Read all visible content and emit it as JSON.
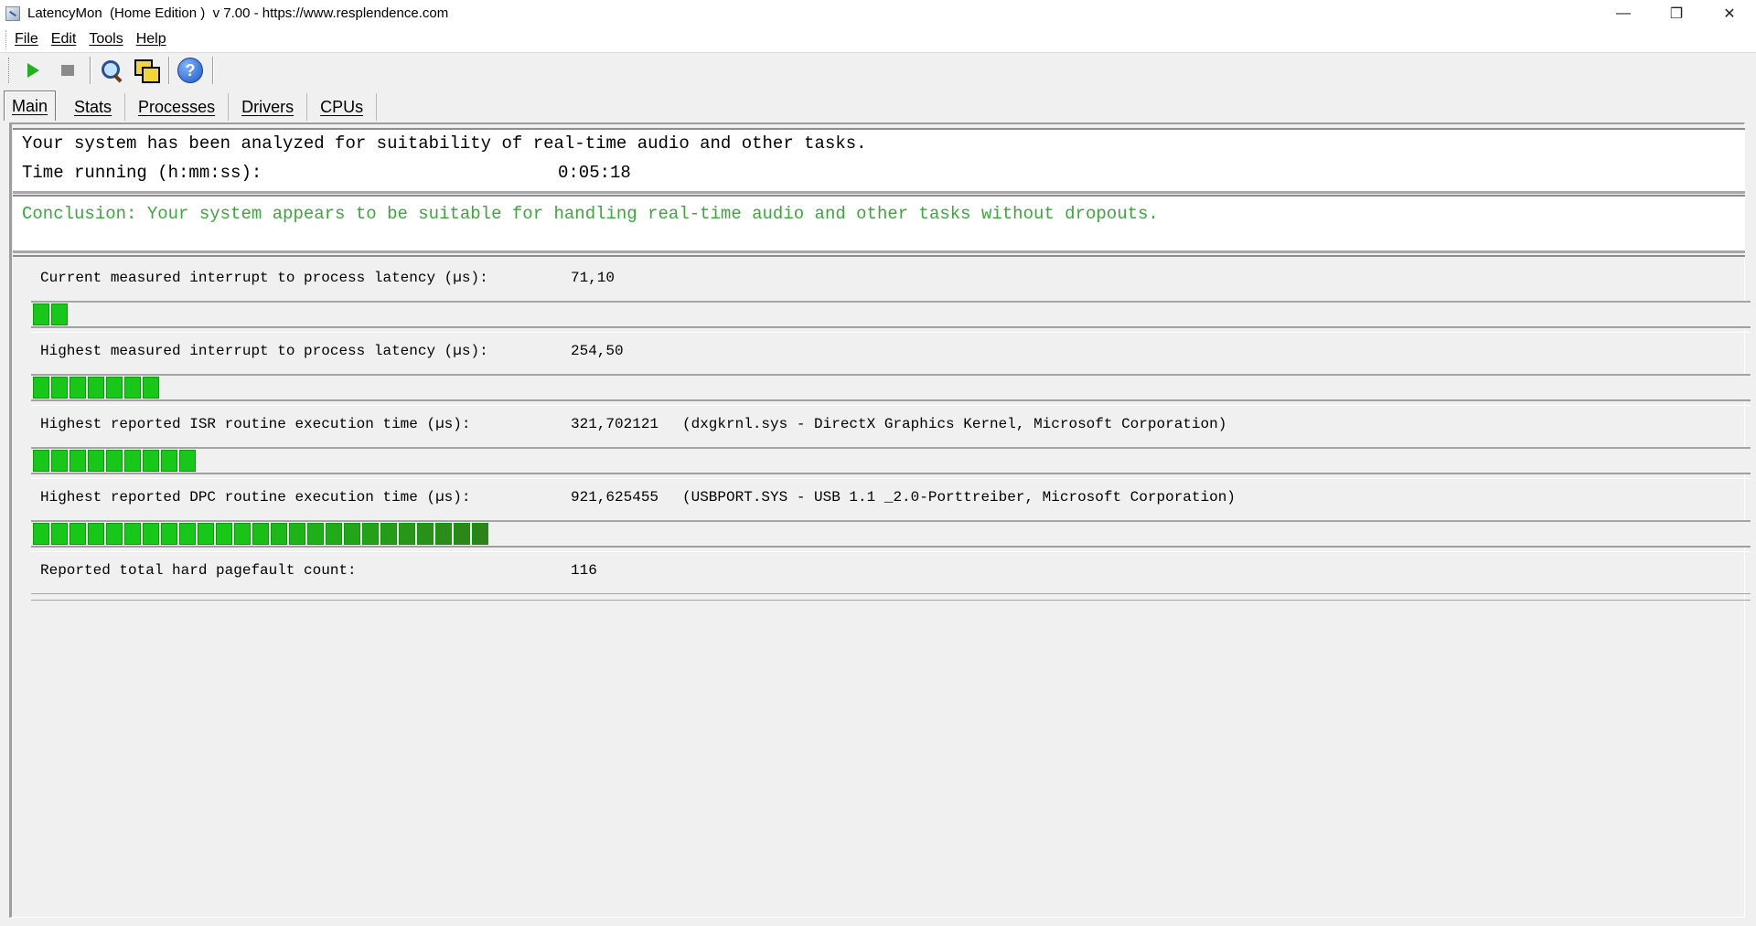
{
  "window": {
    "title": "LatencyMon  (Home Edition )  v 7.00 - https://www.resplendence.com",
    "controls": {
      "minimize": "—",
      "restore": "❐",
      "close": "✕"
    }
  },
  "menu": [
    "File",
    "Edit",
    "Tools",
    "Help"
  ],
  "toolbar": {
    "buttons": [
      "play-icon",
      "stop-icon",
      "analyze-icon",
      "windows-icon",
      "help-icon"
    ],
    "help_glyph": "?"
  },
  "tabs": [
    "Main",
    "Stats",
    "Processes",
    "Drivers",
    "CPUs"
  ],
  "summary": {
    "line1": "Your system has been analyzed for suitability of real-time audio and other tasks.",
    "time_label": "Time running (h:mm:ss):",
    "time_value": "0:05:18",
    "conclusion": "Conclusion: Your system appears to be suitable for handling real-time audio and other tasks without dropouts.",
    "conclusion_color": "#3aa83a"
  },
  "metrics": [
    {
      "label": "Current measured interrupt to process latency (µs):",
      "value": "71,10",
      "detail": "",
      "bar_blocks": 2
    },
    {
      "label": "Highest measured interrupt to process latency (µs):",
      "value": "254,50",
      "detail": "",
      "bar_blocks": 7
    },
    {
      "label": "Highest reported ISR routine execution time (µs):",
      "value": "321,702121",
      "detail": "(dxgkrnl.sys - DirectX Graphics Kernel, Microsoft Corporation)",
      "bar_blocks": 9
    },
    {
      "label": "Highest reported DPC routine execution time (µs):",
      "value": "921,625455",
      "detail": "(USBPORT.SYS - USB 1.1 _2.0-Porttreiber, Microsoft Corporation)",
      "bar_blocks": 25
    },
    {
      "label": "Reported total hard pagefault count:",
      "value": "116",
      "detail": "",
      "bar_blocks": 0
    }
  ],
  "colors": {
    "bar_green": "#18c818",
    "bar_dark_green": "#2e7d1a"
  }
}
